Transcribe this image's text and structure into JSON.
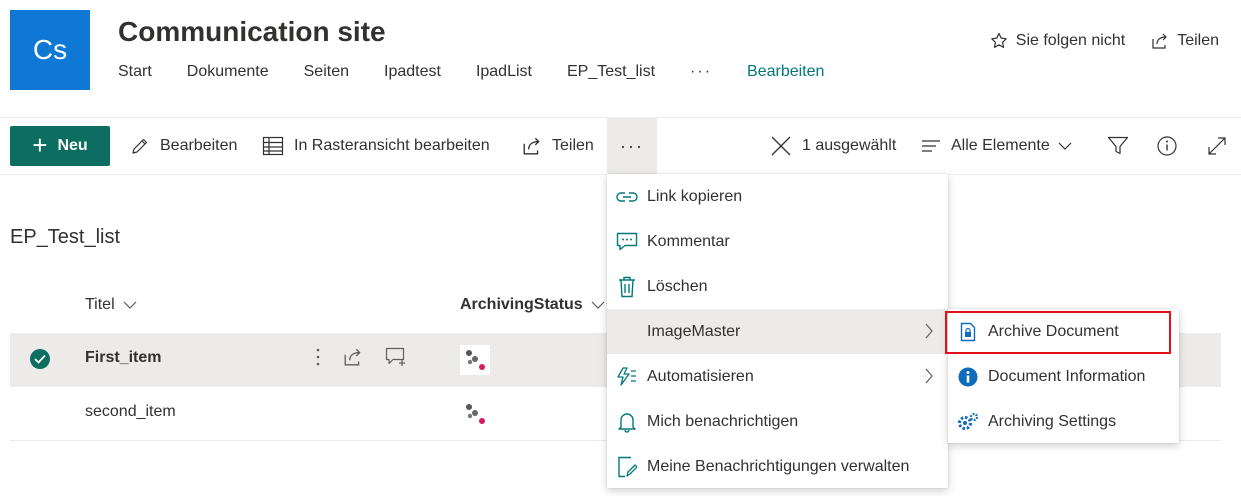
{
  "site": {
    "logo_text": "Cs",
    "title": "Communication site",
    "nav": [
      "Start",
      "Dokumente",
      "Seiten",
      "Ipadtest",
      "IpadList",
      "EP_Test_list"
    ],
    "nav_more": "···",
    "nav_edit": "Bearbeiten",
    "follow_label": "Sie folgen nicht",
    "share_label": "Teilen",
    "logo_color": "#0f78d4"
  },
  "commandbar": {
    "new_label": "Neu",
    "edit_label": "Bearbeiten",
    "grid_edit_label": "In Rasteransicht bearbeiten",
    "share_label": "Teilen",
    "more_label": "···",
    "selected_label": "1 ausgewählt",
    "view_label": "Alle Elemente",
    "accent_color": "#0c6d60"
  },
  "list": {
    "title": "EP_Test_list",
    "columns": [
      "Titel",
      "ArchivingStatus"
    ],
    "rows": [
      {
        "title": "First_item",
        "selected": true
      },
      {
        "title": "second_item",
        "selected": false
      }
    ]
  },
  "context_menu": {
    "items": [
      {
        "label": "Link kopieren",
        "icon": "link-icon"
      },
      {
        "label": "Kommentar",
        "icon": "comment-icon"
      },
      {
        "label": "Löschen",
        "icon": "trash-icon"
      },
      {
        "label": "ImageMaster",
        "icon": "",
        "has_submenu": true
      },
      {
        "label": "Automatisieren",
        "icon": "flow-icon",
        "has_submenu": true
      },
      {
        "label": "Mich benachrichtigen",
        "icon": "bell-icon"
      },
      {
        "label": "Meine Benachrichtigungen verwalten",
        "icon": "manage-alerts-icon"
      }
    ]
  },
  "submenu": {
    "items": [
      {
        "label": "Archive Document",
        "icon": "archive-document-icon",
        "highlighted": true
      },
      {
        "label": "Document Information",
        "icon": "info-icon"
      },
      {
        "label": "Archiving Settings",
        "icon": "settings-gears-icon"
      }
    ],
    "highlight_color": "#e2101a",
    "icon_color": "#0f6cbd"
  }
}
